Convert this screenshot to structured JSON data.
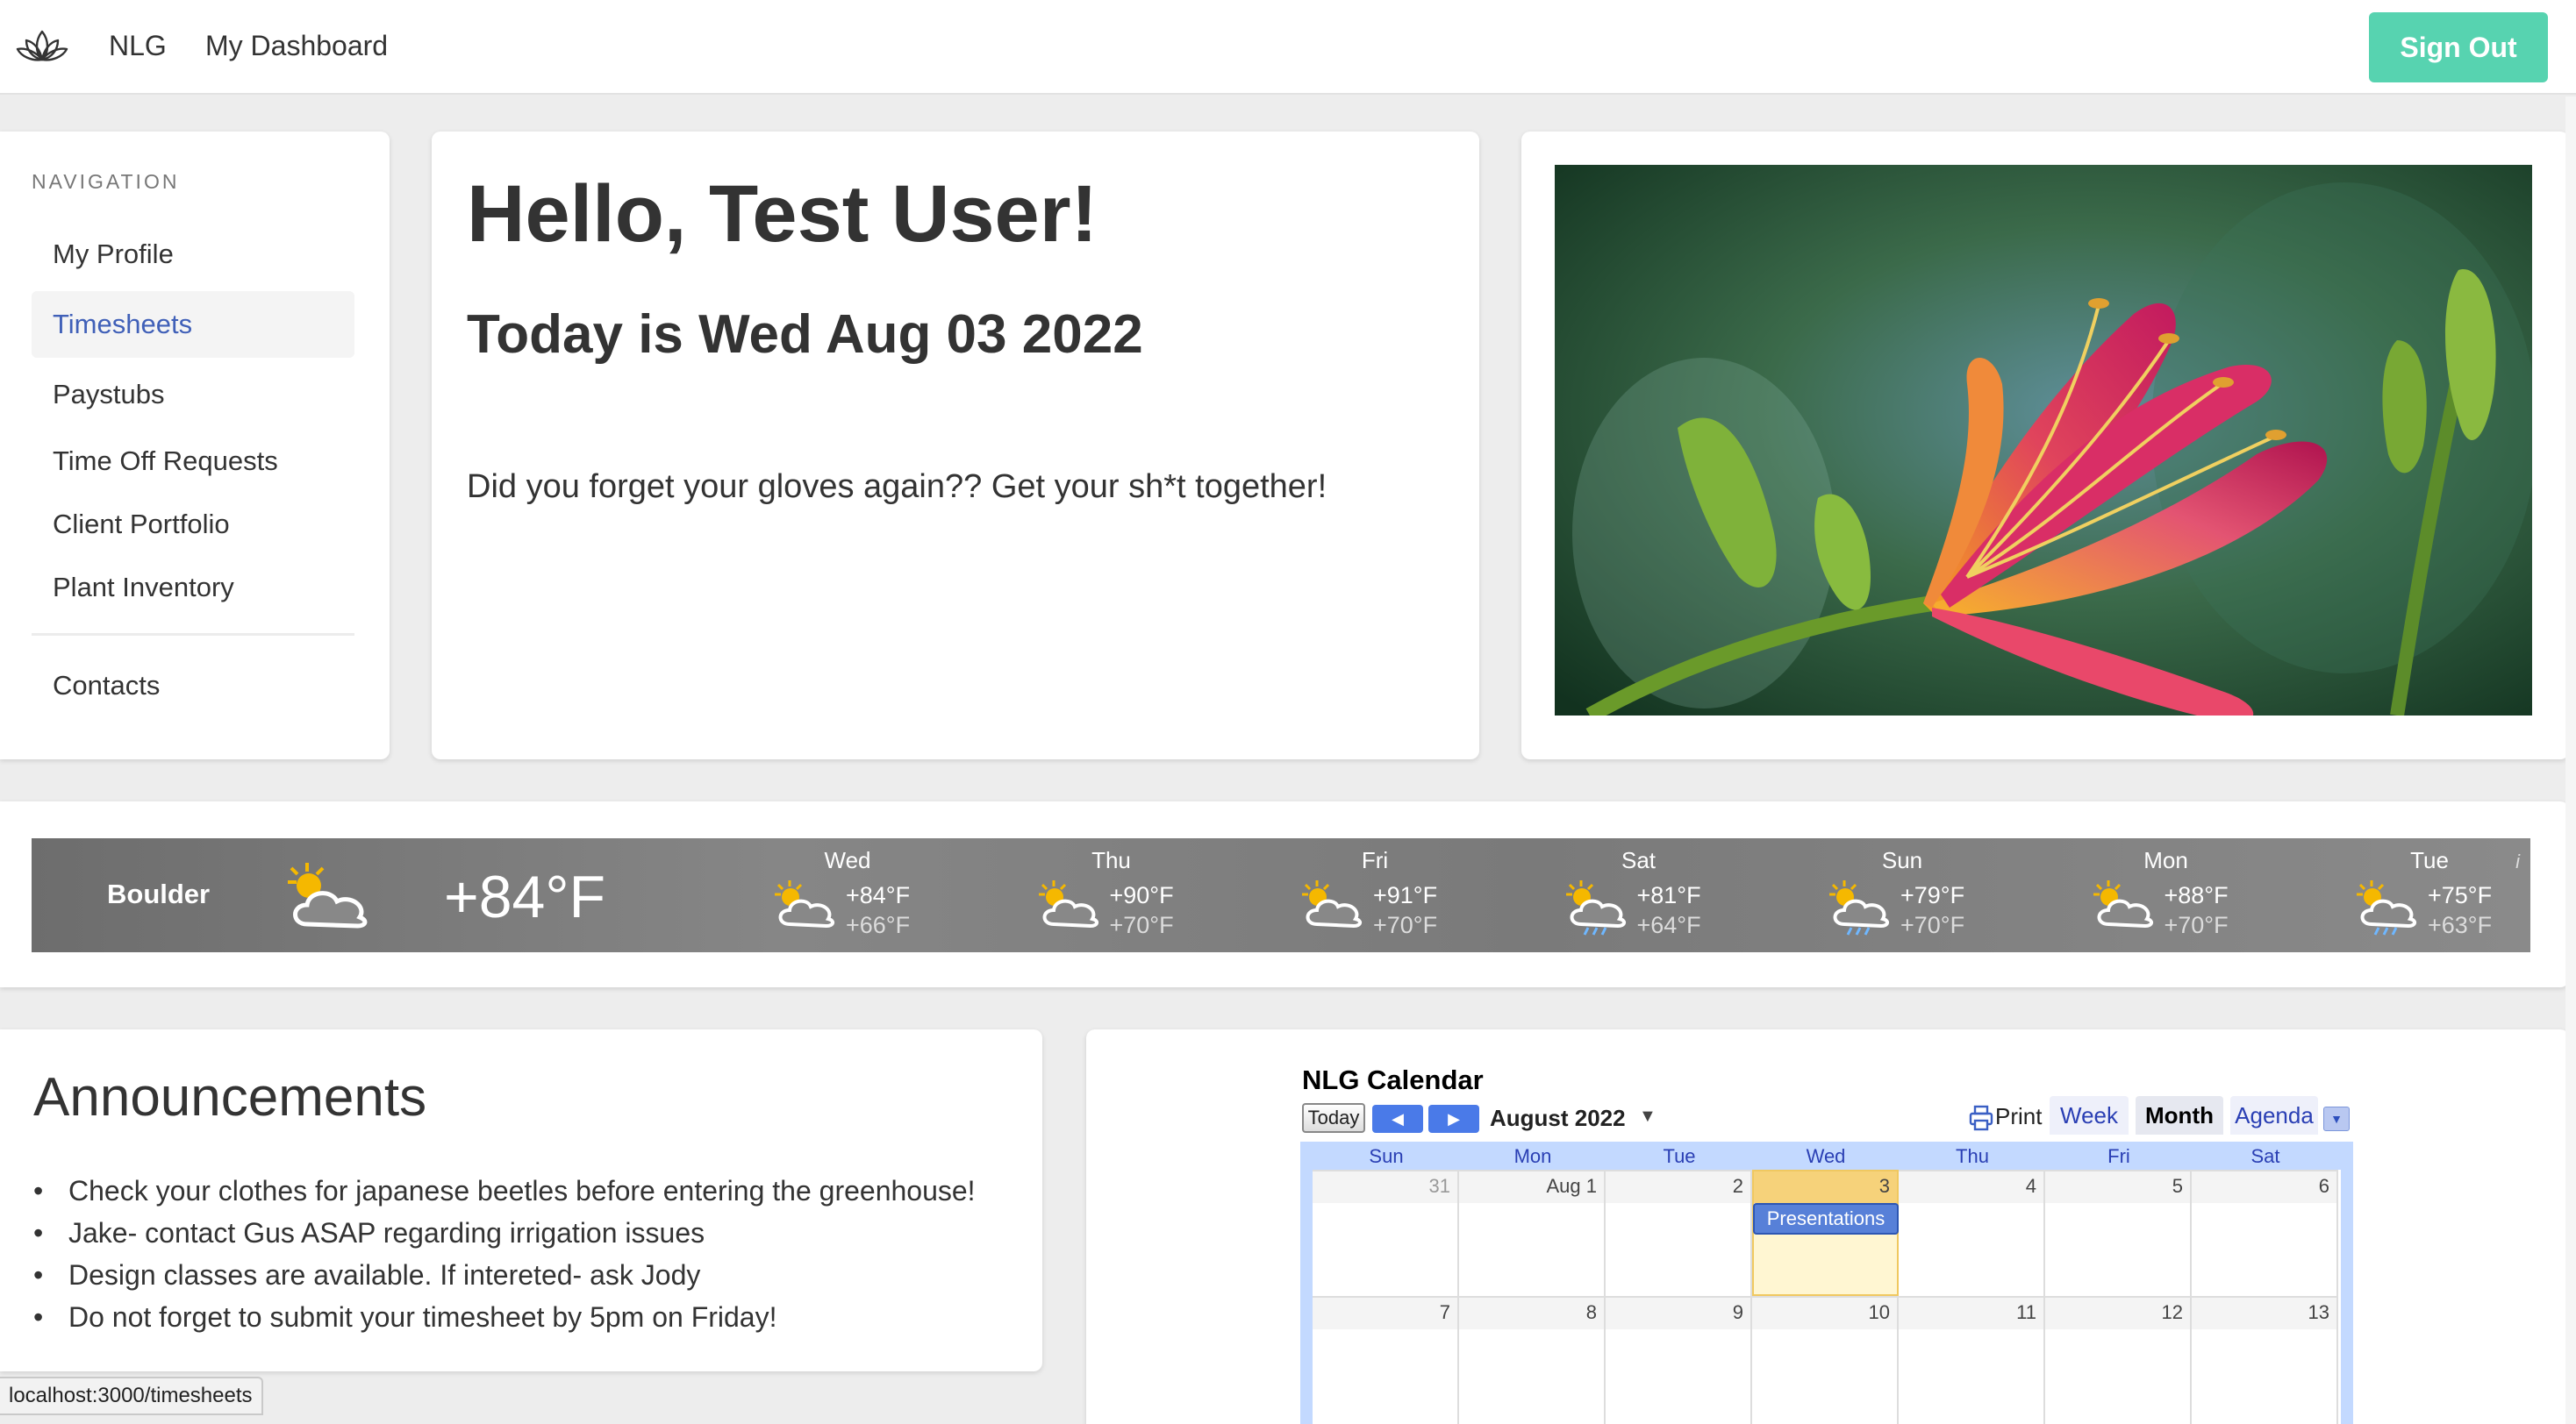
{
  "topnav": {
    "brand": "NLG",
    "dashboard_link": "My Dashboard",
    "signout": "Sign Out",
    "logo_icon": "lotus-icon",
    "accent": "#57d3b0"
  },
  "sidebar": {
    "heading": "NAVIGATION",
    "items": [
      {
        "label": "My Profile"
      },
      {
        "label": "Timesheets"
      },
      {
        "label": "Paystubs"
      },
      {
        "label": "Time Off Requests"
      },
      {
        "label": "Client Portfolio"
      },
      {
        "label": "Plant Inventory"
      },
      {
        "label": "Contacts"
      }
    ],
    "active": "Timesheets",
    "active_color": "#4060b8"
  },
  "greeting": {
    "hello": "Hello, Test User!",
    "today": "Today is Wed Aug 03 2022",
    "message": "Did you forget your gloves again?? Get your sh*t together!"
  },
  "photo": {
    "icon": "lily-flower-photo"
  },
  "weather": {
    "city": "Boulder",
    "current_temp": "+84°F",
    "current_icon": "partly-cloudy-icon",
    "info": "i",
    "days": [
      {
        "name": "Wed",
        "hi": "+84°F",
        "lo": "+66°F",
        "icon": "partly-cloudy-icon"
      },
      {
        "name": "Thu",
        "hi": "+90°F",
        "lo": "+70°F",
        "icon": "partly-cloudy-icon"
      },
      {
        "name": "Fri",
        "hi": "+91°F",
        "lo": "+70°F",
        "icon": "partly-cloudy-icon"
      },
      {
        "name": "Sat",
        "hi": "+81°F",
        "lo": "+64°F",
        "icon": "partly-cloudy-rain-icon"
      },
      {
        "name": "Sun",
        "hi": "+79°F",
        "lo": "+70°F",
        "icon": "partly-cloudy-rain-icon"
      },
      {
        "name": "Mon",
        "hi": "+88°F",
        "lo": "+70°F",
        "icon": "partly-cloudy-icon"
      },
      {
        "name": "Tue",
        "hi": "+75°F",
        "lo": "+63°F",
        "icon": "partly-cloudy-rain-icon"
      }
    ]
  },
  "announcements": {
    "title": "Announcements",
    "items": [
      "Check your clothes for japanese beetles before entering the greenhouse!",
      "Jake- contact Gus ASAP regarding irrigation issues",
      "Design classes are available. If intereted- ask Jody",
      "Do not forget to submit your timesheet by 5pm on Friday!"
    ]
  },
  "calendar": {
    "title": "NLG Calendar",
    "today_btn": "Today",
    "prev": "◀",
    "next": "▶",
    "month": "August 2022",
    "print": "Print",
    "tabs": [
      "Week",
      "Month",
      "Agenda"
    ],
    "selected_tab": "Month",
    "dow": [
      "Sun",
      "Mon",
      "Tue",
      "Wed",
      "Thu",
      "Fri",
      "Sat"
    ],
    "weeks": [
      [
        "31",
        "Aug 1",
        "2",
        "3",
        "4",
        "5",
        "6"
      ],
      [
        "7",
        "8",
        "9",
        "10",
        "11",
        "12",
        "13"
      ]
    ],
    "event": "Presentations",
    "today_highlight": "#fff6d2"
  },
  "statusbar": {
    "url": "localhost:3000/timesheets"
  }
}
